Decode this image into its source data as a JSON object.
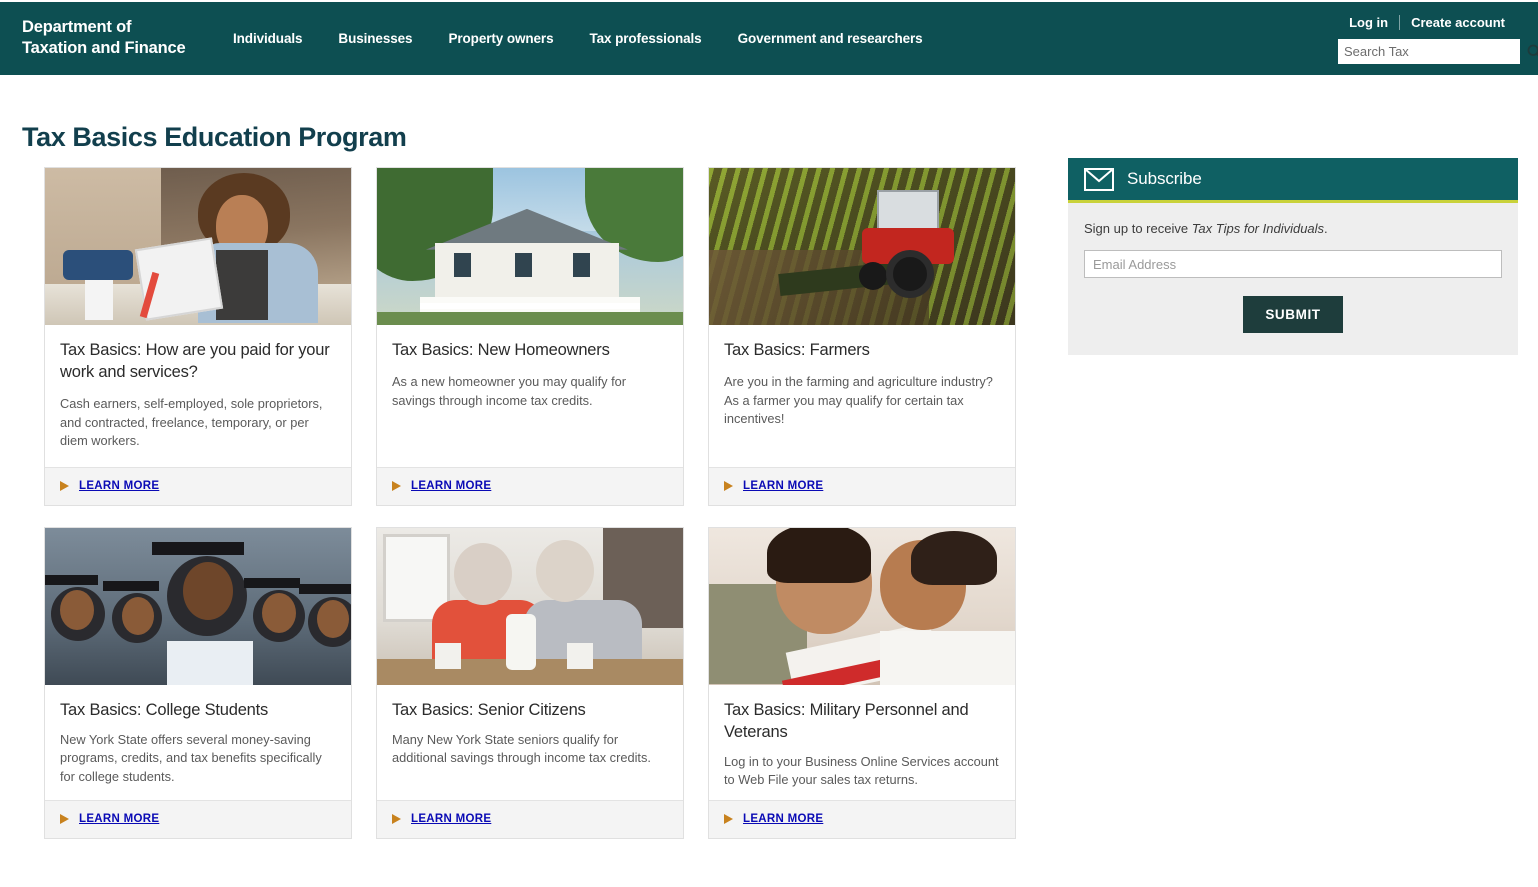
{
  "header": {
    "brand": "Department of\nTaxation and Finance",
    "nav": [
      {
        "label": "Individuals"
      },
      {
        "label": "Businesses"
      },
      {
        "label": "Property owners"
      },
      {
        "label": "Tax professionals"
      },
      {
        "label": "Government and researchers"
      }
    ],
    "login_label": "Log in",
    "create_account_label": "Create account",
    "search": {
      "placeholder": "Search Tax",
      "value": "",
      "icon": "search-icon"
    },
    "background_color": "#0d4f52"
  },
  "page": {
    "title": "Tax Basics Education Program",
    "title_color": "#123f4d"
  },
  "cards": [
    {
      "title": "Tax Basics: How are you paid for your work and services?",
      "description": "Cash earners, self-employed, sole  proprietors, and contracted, freelance, temporary, or per diem workers.",
      "link_label": "LEARN MORE",
      "image_alt": "woman-with-tablet-in-workshop"
    },
    {
      "title": "Tax Basics: New Homeowners",
      "description": "As a new homeowner you may qualify for savings through income tax credits.",
      "link_label": "LEARN MORE",
      "image_alt": "white-house-with-porch"
    },
    {
      "title": "Tax Basics: Farmers",
      "description": "Are you in the farming and agriculture industry? As a farmer you may qualify for certain tax incentives!",
      "link_label": "LEARN MORE",
      "image_alt": "red-tractor-plowing-field"
    },
    {
      "title": "Tax Basics: College Students",
      "description": "New York State offers several money-saving programs, credits, and tax benefits specifically for college students.",
      "link_label": "LEARN MORE",
      "image_alt": "graduating-students-in-caps-and-gowns"
    },
    {
      "title": "Tax Basics: Senior Citizens",
      "description": "Many New York State seniors qualify for additional savings through income tax credits.",
      "link_label": "LEARN MORE",
      "image_alt": "senior-couple-at-breakfast-table"
    },
    {
      "title": "Tax Basics: Military Personnel and Veterans",
      "description": "Log in to your Business Online Services account to Web File your sales tax returns.",
      "link_label": "LEARN MORE",
      "image_alt": "servicemember-mother-with-child"
    }
  ],
  "subscribe": {
    "heading": "Subscribe",
    "icon": "envelope-icon",
    "signup_prefix": "Sign up to receive ",
    "signup_emphasis": "Tax Tips for Individuals",
    "signup_suffix": ".",
    "email_placeholder": "Email Address",
    "email_value": "",
    "submit_label": "SUBMIT",
    "header_color": "#0f6063",
    "accent_color": "#c9d23a",
    "body_color": "#eeeeee"
  },
  "theme": {
    "link_color": "#0a0ab5",
    "arrow_color": "#c8821e",
    "card_footer_bg": "#f4f4f4"
  }
}
